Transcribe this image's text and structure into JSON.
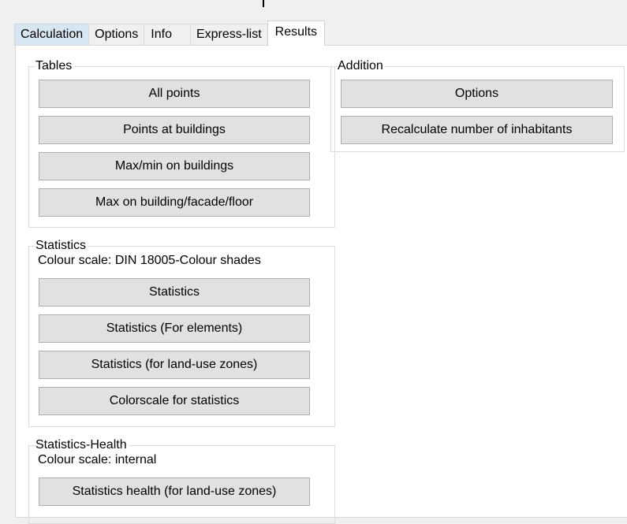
{
  "tabs": [
    {
      "label": "Calculation",
      "state": "hovered"
    },
    {
      "label": "Options",
      "state": "normal"
    },
    {
      "label": "Info",
      "state": "normal"
    },
    {
      "label": "Express-list",
      "state": "normal"
    },
    {
      "label": "Results",
      "state": "active"
    }
  ],
  "tables": {
    "title": "Tables",
    "buttons": [
      "All points",
      "Points at buildings",
      "Max/min on buildings",
      "Max on building/facade/floor"
    ]
  },
  "addition": {
    "title": "Addition",
    "buttons": [
      "Options",
      "Recalculate number of inhabitants"
    ]
  },
  "statistics": {
    "title": "Statistics",
    "colour_scale": "Colour scale: DIN 18005-Colour shades",
    "buttons": [
      "Statistics",
      "Statistics (For elements)",
      "Statistics (for land-use zones)",
      "Colorscale for statistics"
    ]
  },
  "statistics_health": {
    "title": "Statistics-Health",
    "colour_scale": "Colour scale: internal",
    "buttons": [
      "Statistics health (for land-use zones)"
    ]
  },
  "colors": {
    "hover_tab": "#d8e6f2",
    "button_face": "#e1e1e1",
    "button_border": "#adadad",
    "panel_bg": "#ffffff",
    "window_bg": "#f0f0f0"
  }
}
